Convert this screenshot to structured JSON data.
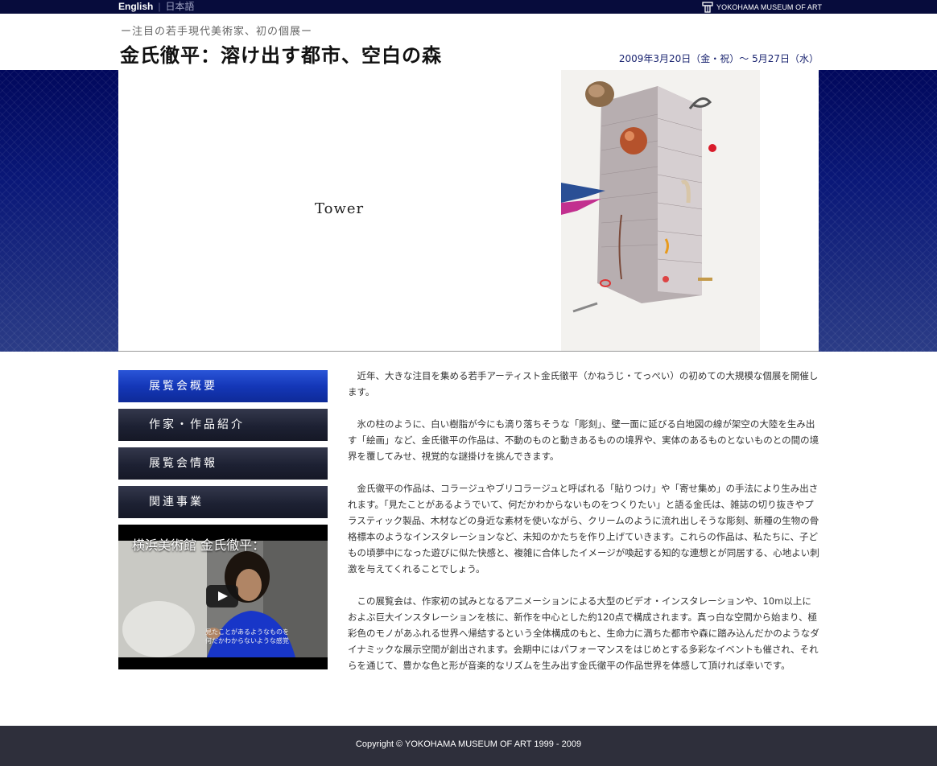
{
  "topbar": {
    "lang_english": "English",
    "lang_separator": "|",
    "lang_japanese": "日本語",
    "museum_name": "YOKOHAMA MUSEUM OF ART"
  },
  "header": {
    "subtitle": "ー注目の若手現代美術家、初の個展ー",
    "title": "金氏徹平：溶け出す都市、空白の森",
    "date": "2009年3月20日（金・祝）〜 5月27日（水）"
  },
  "hero": {
    "label": "Tower"
  },
  "sidebar": {
    "items": [
      {
        "label": "展覧会概要",
        "active": true
      },
      {
        "label": "作家・作品紹介",
        "active": false
      },
      {
        "label": "展覧会情報",
        "active": false
      },
      {
        "label": "関連事業",
        "active": false
      }
    ],
    "video": {
      "title": "横浜美術館 金氏徹平：",
      "caption_line1": "見たことがあるようなものを",
      "caption_line2": "何だかわからないような感覚"
    }
  },
  "content": {
    "paragraphs": [
      "近年、大きな注目を集める若手アーティスト金氏徹平（かねうじ・てっぺい）の初めての大規模な個展を開催します。",
      "氷の柱のように、白い樹脂が今にも滴り落ちそうな「彫刻」、壁一面に延びる白地図の線が架空の大陸を生み出す「絵画」など、金氏徹平の作品は、不動のものと動きあるものの境界や、実体のあるものとないものとの間の境界を覆してみせ、視覚的な謎掛けを挑んできます。",
      "金氏徹平の作品は、コラージュやブリコラージュと呼ばれる「貼りつけ」や「寄せ集め」の手法により生み出されます。「見たことがあるようでいて、何だかわからないものをつくりたい」と語る金氏は、雑誌の切り抜きやプラスティック製品、木材などの身近な素材を使いながら、クリームのように流れ出しそうな彫刻、新種の生物の骨格標本のようなインスタレーションなど、未知のかたちを作り上げていきます。これらの作品は、私たちに、子どもの頃夢中になった遊びに似た快感と、複雑に合体したイメージが喚起する知的な連想とが同居する、心地よい刺激を与えてくれることでしょう。",
      "この展覧会は、作家初の試みとなるアニメーションによる大型のビデオ・インスタレーションや、10m以上におよぶ巨大インスタレーションを核に、新作を中心とした約120点で構成されます。真っ白な空間から始まり、極彩色のモノがあふれる世界へ帰結するという全体構成のもと、生命力に満ちた都市や森に踏み込んだかのようなダイナミックな展示空間が創出されます。会期中にはパフォーマンスをはじめとする多彩なイベントも催され、それらを通じて、豊かな色と形が音楽的なリズムを生み出す金氏徹平の作品世界を体感して頂ければ幸いです。"
    ]
  },
  "footer": {
    "copyright": "Copyright © YOKOHAMA MUSEUM OF ART 1999 - 2009"
  },
  "colors": {
    "topbar": "#070c3c",
    "hero_blue": "#01085c",
    "nav_active": "#1437b8",
    "nav_default": "#1d2133",
    "footer": "#2e2f3b",
    "date_text": "#1a2470"
  }
}
